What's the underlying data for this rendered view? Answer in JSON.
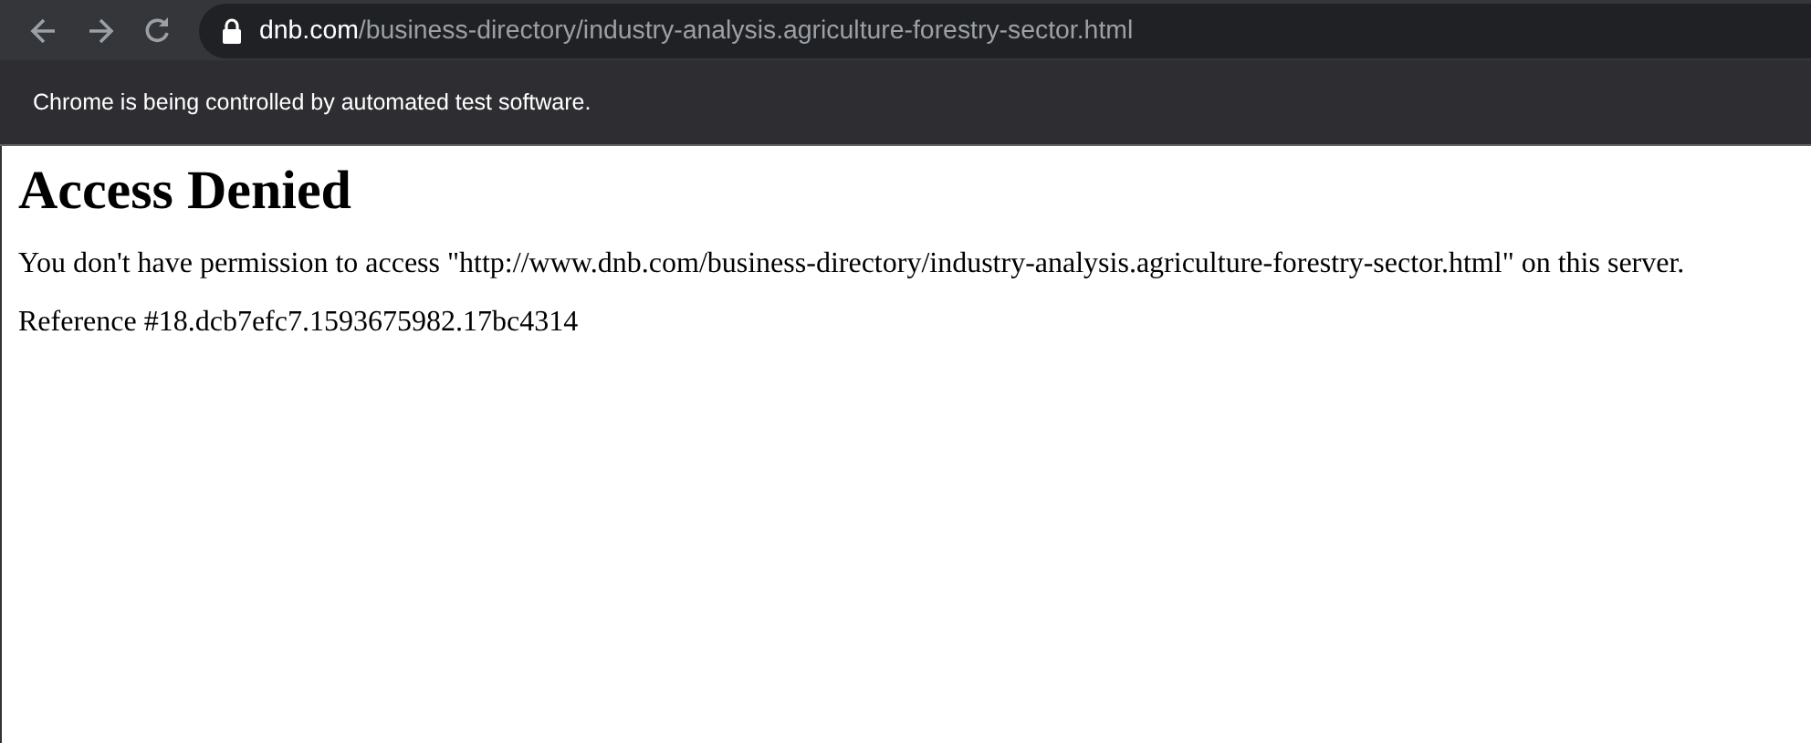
{
  "browser": {
    "url_host": "dnb.com",
    "url_path": "/business-directory/industry-analysis.agriculture-forestry-sector.html",
    "infobar": "Chrome is being controlled by automated test software."
  },
  "page": {
    "heading": "Access Denied",
    "message": "You don't have permission to access \"http://www.dnb.com/business-directory/industry-analysis.agriculture-forestry-sector.html\" on this server.",
    "reference": "Reference #18.dcb7efc7.1593675982.17bc4314"
  }
}
